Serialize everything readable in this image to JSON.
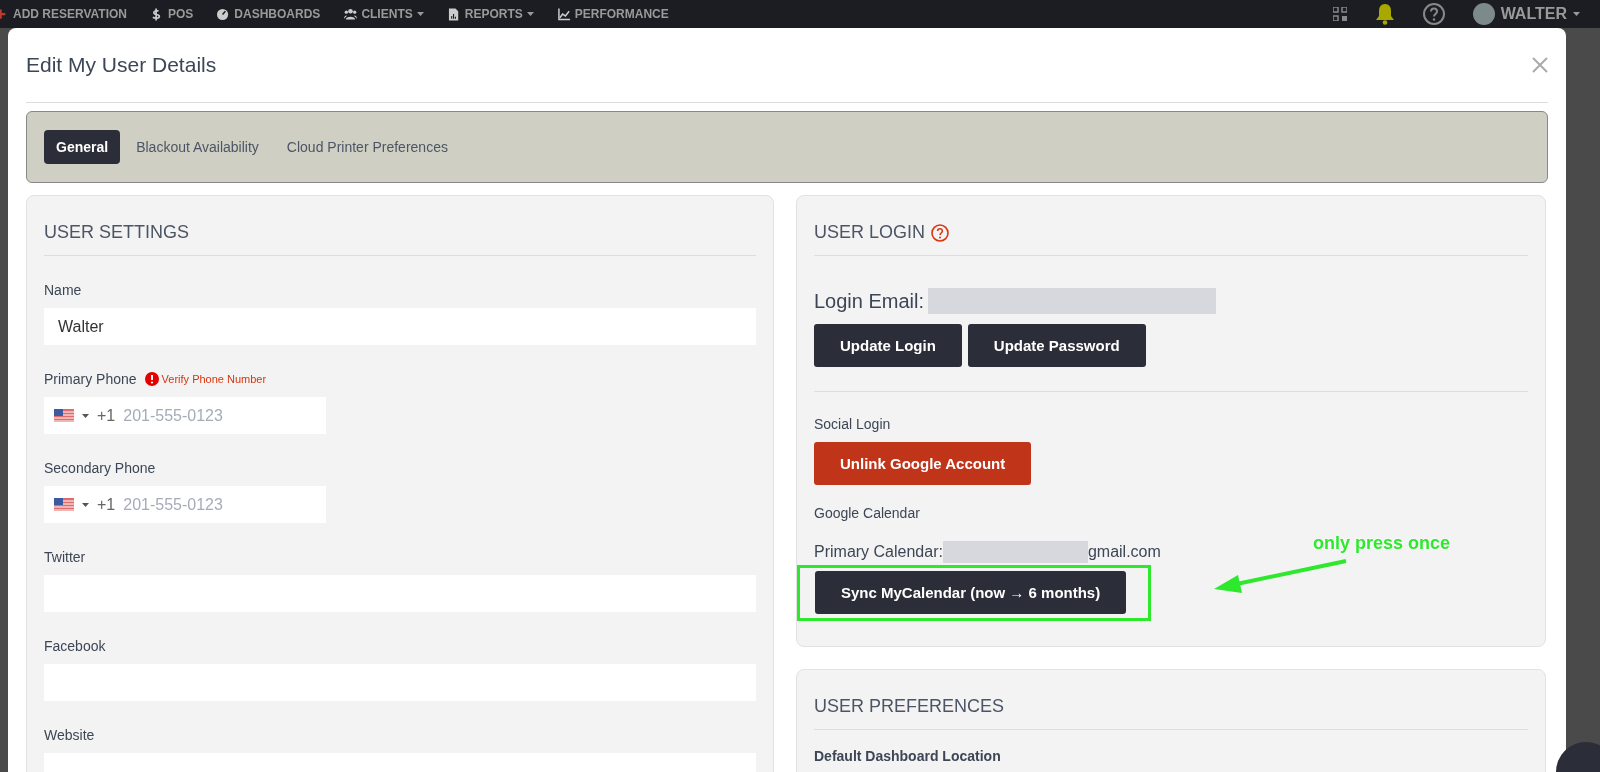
{
  "nav": {
    "items": [
      {
        "label": "ADD RESERVATION",
        "caret": false
      },
      {
        "label": "POS",
        "caret": false
      },
      {
        "label": "DASHBOARDS",
        "caret": false
      },
      {
        "label": "CLIENTS",
        "caret": true
      },
      {
        "label": "REPORTS",
        "caret": true
      },
      {
        "label": "PERFORMANCE",
        "caret": false
      }
    ],
    "user": "WALTER"
  },
  "modal": {
    "title": "Edit My User Details",
    "tabs": [
      {
        "label": "General",
        "selected": true
      },
      {
        "label": "Blackout Availability",
        "selected": false
      },
      {
        "label": "Cloud Printer Preferences",
        "selected": false
      }
    ],
    "user_settings": {
      "heading": "USER SETTINGS",
      "fields": [
        {
          "kind": "text",
          "label": "Name",
          "value": "Walter"
        },
        {
          "kind": "phone",
          "label": "Primary Phone",
          "dial_code": "+1",
          "placeholder": "201-555-0123",
          "warning": "Verify Phone Number"
        },
        {
          "kind": "phone",
          "label": "Secondary Phone",
          "dial_code": "+1",
          "placeholder": "201-555-0123"
        },
        {
          "kind": "text",
          "label": "Twitter"
        },
        {
          "kind": "text",
          "label": "Facebook"
        },
        {
          "kind": "text",
          "label": "Website"
        }
      ]
    },
    "user_login": {
      "heading": "USER LOGIN",
      "email_label": "Login Email:",
      "buttons": [
        "Update Login",
        "Update Password"
      ],
      "social_label": "Social Login",
      "unlink_button": "Unlink Google Account",
      "calendar_label": "Google Calendar",
      "primary_calendar_label": "Primary Calendar:",
      "calendar_suffix": "gmail.com",
      "sync_button": "Sync MyCalendar (now → 6 months)"
    },
    "user_preferences": {
      "heading": "USER PREFERENCES",
      "field_label": "Default Dashboard Location"
    }
  },
  "annotation": {
    "text": "only press once"
  }
}
